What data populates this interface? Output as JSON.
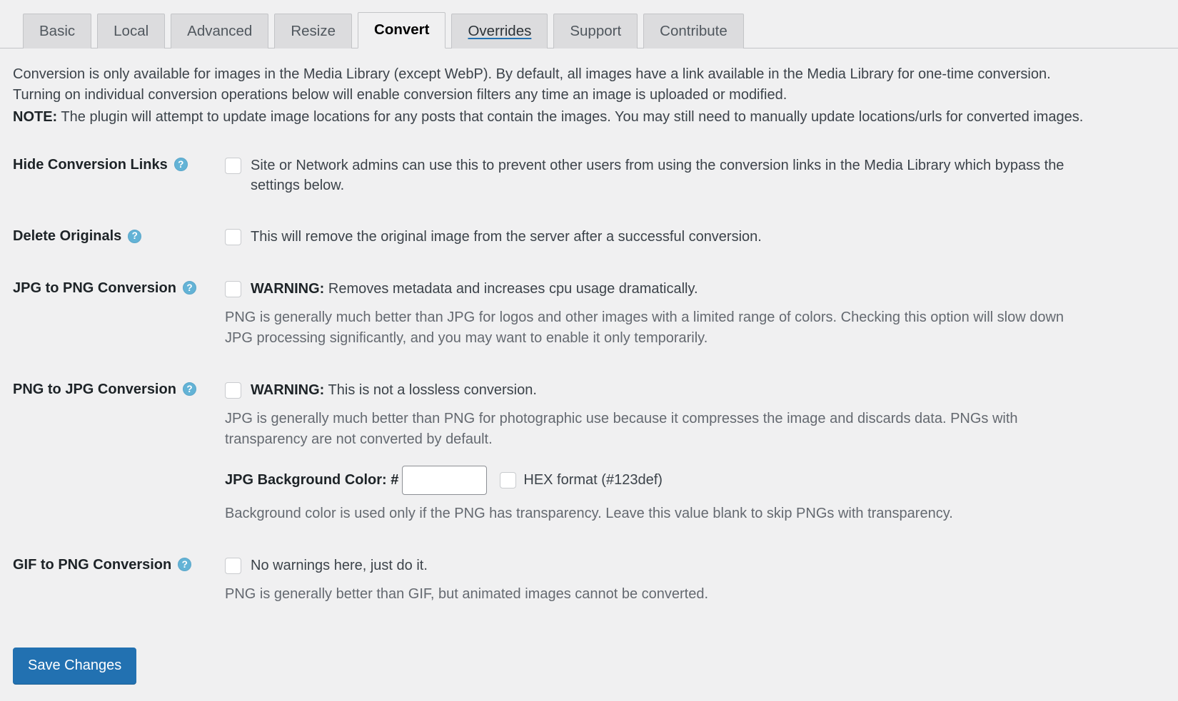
{
  "tabs": [
    {
      "label": "Basic",
      "state": "normal"
    },
    {
      "label": "Local",
      "state": "normal"
    },
    {
      "label": "Advanced",
      "state": "normal"
    },
    {
      "label": "Resize",
      "state": "normal"
    },
    {
      "label": "Convert",
      "state": "active"
    },
    {
      "label": "Overrides",
      "state": "hovered"
    },
    {
      "label": "Support",
      "state": "normal"
    },
    {
      "label": "Contribute",
      "state": "normal"
    }
  ],
  "intro": {
    "paragraph": "Conversion is only available for images in the Media Library (except WebP). By default, all images have a link available in the Media Library for one-time conversion. Turning on individual conversion operations below will enable conversion filters any time an image is uploaded or modified.",
    "note_label": "NOTE:",
    "note_text": "The plugin will attempt to update image locations for any posts that contain the images. You may still need to manually update locations/urls for converted images."
  },
  "rows": {
    "hide_conversion_links": {
      "label": "Hide Conversion Links",
      "help_icon": "question-circle-icon",
      "checkbox_label": "Site or Network admins can use this to prevent other users from using the conversion links in the Media Library which bypass the settings below.",
      "checked": false
    },
    "delete_originals": {
      "label": "Delete Originals",
      "help_icon": "question-circle-icon",
      "checkbox_label": "This will remove the original image from the server after a successful conversion.",
      "checked": false
    },
    "jpg_to_png": {
      "label": "JPG to PNG Conversion",
      "help_icon": "question-circle-icon",
      "warning_prefix": "WARNING:",
      "checkbox_label": "Removes metadata and increases cpu usage dramatically.",
      "description": "PNG is generally much better than JPG for logos and other images with a limited range of colors. Checking this option will slow down JPG processing significantly, and you may want to enable it only temporarily.",
      "checked": false
    },
    "png_to_jpg": {
      "label": "PNG to JPG Conversion",
      "help_icon": "question-circle-icon",
      "warning_prefix": "WARNING:",
      "checkbox_label": "This is not a lossless conversion.",
      "description": "JPG is generally much better than PNG for photographic use because it compresses the image and discards data. PNGs with transparency are not converted by default.",
      "bg_color_label": "JPG Background Color: #",
      "bg_color_value": "",
      "bg_color_placeholder": "",
      "hex_format_label": "HEX format (#123def)",
      "hex_checked": false,
      "footnote": "Background color is used only if the PNG has transparency. Leave this value blank to skip PNGs with transparency.",
      "checked": false
    },
    "gif_to_png": {
      "label": "GIF to PNG Conversion",
      "help_icon": "question-circle-icon",
      "checkbox_label": "No warnings here, just do it.",
      "description": "PNG is generally better than GIF, but animated images cannot be converted.",
      "checked": false
    }
  },
  "submit": {
    "save_label": "Save Changes"
  },
  "colors": {
    "accent": "#2271b1",
    "help_icon": "#63b3d6",
    "page_bg": "#f0f0f1",
    "tab_bg": "#dcdcde",
    "border": "#c3c4c7"
  }
}
